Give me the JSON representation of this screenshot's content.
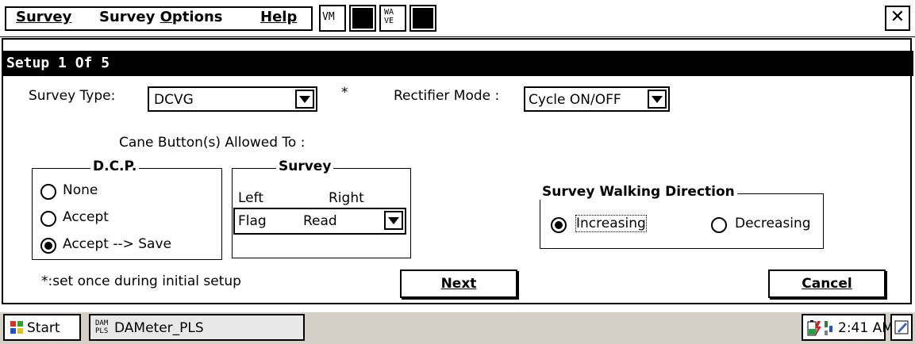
{
  "menubar": {
    "survey": "Survey",
    "survey_options_pre": "Survey ",
    "survey_options_u": "O",
    "survey_options_post": "ptions",
    "help": "Help",
    "tool1": "VM",
    "tool3": "WA\nVE"
  },
  "dialog": {
    "title": "Setup 1 Of 5",
    "survey_type_label": "Survey Type:",
    "survey_type_value": "DCVG",
    "asterisk": "*",
    "rectifier_mode_label": "Rectifier Mode :",
    "rectifier_mode_value": "Cycle ON/OFF",
    "cane_label": "Cane Button(s) Allowed To :",
    "dcp": {
      "legend": "D.C.P.",
      "options": [
        "None",
        "Accept",
        "Accept --> Save"
      ],
      "selected_index": 2
    },
    "survey_group": {
      "legend": "Survey",
      "left_label": "Left",
      "right_label": "Right",
      "combo_left": "Flag",
      "combo_right": "Read"
    },
    "walking": {
      "legend": "Survey Walking Direction",
      "increasing": "Increasing",
      "decreasing": "Decreasing",
      "selected": "Increasing"
    },
    "footnote": "*:set once during initial setup",
    "next": "Next",
    "cancel": "Cancel"
  },
  "taskbar": {
    "start": "Start",
    "app_icon": "DAM\nPLS",
    "app": "DAMeter_PLS",
    "time": "2:41 AM"
  }
}
